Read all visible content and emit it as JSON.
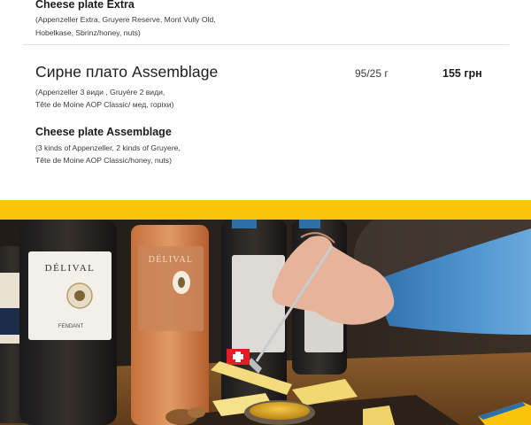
{
  "items": [
    {
      "en_title": "Cheese plate Extra",
      "en_desc_line1": "(Appenzeller Extra, Gruyere Reserve, Mont Vully Old,",
      "en_desc_line2": "Hobelkase, Sbrinz/honey, nuts)"
    },
    {
      "ua_title": "Сирне плато Assemblage",
      "weight": "95/25 г",
      "price": "155 грн",
      "ua_desc_line1": "(Appenzeller 3 види , Gruyère 2 види,",
      "ua_desc_line2": "Tête de Moine AOP Classic/ мед, горіхи)",
      "en_title": "Cheese plate Assemblage",
      "en_desc_line1": "(3 kinds of Appenzeller, 2 kinds of Gruyere,",
      "en_desc_line2": "Tête de Moine AOP Classic/honey, nuts)"
    }
  ],
  "photo": {
    "bottle_label_1": "DÉLIVAL",
    "bottle_label_2": "DÉLIVAL",
    "bottle_small_1": "FENDANT"
  },
  "colors": {
    "accent": "#fcc30b",
    "divider": "#e3e3e3"
  }
}
